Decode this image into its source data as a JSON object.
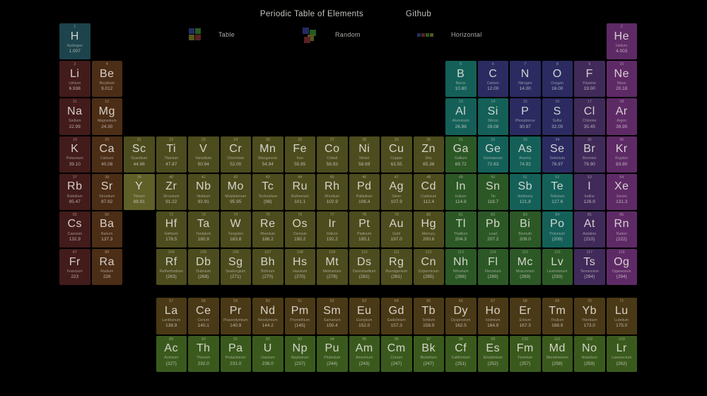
{
  "header": {
    "title": "Periodic Table of Elements",
    "github_label": "Github",
    "modes": [
      {
        "label": "Table"
      },
      {
        "label": "Random"
      },
      {
        "label": "Horizontal"
      }
    ]
  },
  "icon_palette": {
    "blue": "#232c62",
    "red": "#5a2121",
    "green": "#265a21",
    "olive": "#55551e"
  },
  "colors": {
    "hydrogen": "#1d434c",
    "alkali": "#421b1b",
    "alkaline": "#4c2d16",
    "transition": "#4c4c1e",
    "transition_hl": "#5f5f28",
    "post": "#2c5826",
    "metalloid": "#146058",
    "nonmetal": "#2b2b61",
    "halogen": "#402a59",
    "noble": "#5e2a66",
    "lanthanide": "#4a3916",
    "actinide": "#3a5a1d"
  },
  "elements": [
    {
      "n": 1,
      "s": "H",
      "name": "Hydrogen",
      "m": "1.007",
      "r": 1,
      "c": 1,
      "cat": "hydrogen"
    },
    {
      "n": 2,
      "s": "He",
      "name": "Helium",
      "m": "4.003",
      "r": 1,
      "c": 18,
      "cat": "noble"
    },
    {
      "n": 3,
      "s": "Li",
      "name": "Lithium",
      "m": "6.938",
      "r": 2,
      "c": 1,
      "cat": "alkali"
    },
    {
      "n": 4,
      "s": "Be",
      "name": "Beryllium",
      "m": "9.012",
      "r": 2,
      "c": 2,
      "cat": "alkaline"
    },
    {
      "n": 5,
      "s": "B",
      "name": "Boron",
      "m": "10.80",
      "r": 2,
      "c": 13,
      "cat": "metalloid"
    },
    {
      "n": 6,
      "s": "C",
      "name": "Carbon",
      "m": "12.00",
      "r": 2,
      "c": 14,
      "cat": "nonmetal"
    },
    {
      "n": 7,
      "s": "N",
      "name": "Nitrogen",
      "m": "14.00",
      "r": 2,
      "c": 15,
      "cat": "nonmetal"
    },
    {
      "n": 8,
      "s": "O",
      "name": "Oxygen",
      "m": "16.00",
      "r": 2,
      "c": 16,
      "cat": "nonmetal"
    },
    {
      "n": 9,
      "s": "F",
      "name": "Fluorine",
      "m": "19.00",
      "r": 2,
      "c": 17,
      "cat": "halogen"
    },
    {
      "n": 10,
      "s": "Ne",
      "name": "Neon",
      "m": "20.18",
      "r": 2,
      "c": 18,
      "cat": "noble"
    },
    {
      "n": 11,
      "s": "Na",
      "name": "Sodium",
      "m": "22.99",
      "r": 3,
      "c": 1,
      "cat": "alkali"
    },
    {
      "n": 12,
      "s": "Mg",
      "name": "Magnesium",
      "m": "24.30",
      "r": 3,
      "c": 2,
      "cat": "alkaline"
    },
    {
      "n": 13,
      "s": "Al",
      "name": "Aluminium",
      "m": "26.98",
      "r": 3,
      "c": 13,
      "cat": "metalloid"
    },
    {
      "n": 14,
      "s": "Si",
      "name": "Silicon",
      "m": "28.08",
      "r": 3,
      "c": 14,
      "cat": "metalloid"
    },
    {
      "n": 15,
      "s": "P",
      "name": "Phosphorus",
      "m": "30.97",
      "r": 3,
      "c": 15,
      "cat": "nonmetal"
    },
    {
      "n": 16,
      "s": "S",
      "name": "Sulfur",
      "m": "32.05",
      "r": 3,
      "c": 16,
      "cat": "nonmetal"
    },
    {
      "n": 17,
      "s": "Cl",
      "name": "Chlorine",
      "m": "35.45",
      "r": 3,
      "c": 17,
      "cat": "halogen"
    },
    {
      "n": 18,
      "s": "Ar",
      "name": "Argon",
      "m": "39.95",
      "r": 3,
      "c": 18,
      "cat": "noble"
    },
    {
      "n": 19,
      "s": "K",
      "name": "Potassium",
      "m": "39.10",
      "r": 4,
      "c": 1,
      "cat": "alkali"
    },
    {
      "n": 20,
      "s": "Ca",
      "name": "Calcium",
      "m": "40.08",
      "r": 4,
      "c": 2,
      "cat": "alkaline"
    },
    {
      "n": 21,
      "s": "Sc",
      "name": "Scandium",
      "m": "44.96",
      "r": 4,
      "c": 3,
      "cat": "transition"
    },
    {
      "n": 22,
      "s": "Ti",
      "name": "Titanium",
      "m": "47.87",
      "r": 4,
      "c": 4,
      "cat": "transition"
    },
    {
      "n": 23,
      "s": "V",
      "name": "Vanadium",
      "m": "50.94",
      "r": 4,
      "c": 5,
      "cat": "transition"
    },
    {
      "n": 24,
      "s": "Cr",
      "name": "Chromium",
      "m": "52.00",
      "r": 4,
      "c": 6,
      "cat": "transition"
    },
    {
      "n": 25,
      "s": "Mn",
      "name": "Manganese",
      "m": "54.94",
      "r": 4,
      "c": 7,
      "cat": "transition"
    },
    {
      "n": 26,
      "s": "Fe",
      "name": "Iron",
      "m": "55.85",
      "r": 4,
      "c": 8,
      "cat": "transition"
    },
    {
      "n": 27,
      "s": "Co",
      "name": "Cobalt",
      "m": "58.93",
      "r": 4,
      "c": 9,
      "cat": "transition"
    },
    {
      "n": 28,
      "s": "Ni",
      "name": "Nickel",
      "m": "58.69",
      "r": 4,
      "c": 10,
      "cat": "transition"
    },
    {
      "n": 29,
      "s": "Cu",
      "name": "Copper",
      "m": "63.55",
      "r": 4,
      "c": 11,
      "cat": "transition"
    },
    {
      "n": 30,
      "s": "Zn",
      "name": "Zinc",
      "m": "65.38",
      "r": 4,
      "c": 12,
      "cat": "transition"
    },
    {
      "n": 31,
      "s": "Ga",
      "name": "Gallium",
      "m": "69.72",
      "r": 4,
      "c": 13,
      "cat": "post"
    },
    {
      "n": 32,
      "s": "Ge",
      "name": "Germanium",
      "m": "72.63",
      "r": 4,
      "c": 14,
      "cat": "metalloid"
    },
    {
      "n": 33,
      "s": "As",
      "name": "Arsenic",
      "m": "74.92",
      "r": 4,
      "c": 15,
      "cat": "metalloid"
    },
    {
      "n": 34,
      "s": "Se",
      "name": "Selenium",
      "m": "78.97",
      "r": 4,
      "c": 16,
      "cat": "nonmetal"
    },
    {
      "n": 35,
      "s": "Br",
      "name": "Bromine",
      "m": "79.90",
      "r": 4,
      "c": 17,
      "cat": "halogen"
    },
    {
      "n": 36,
      "s": "Kr",
      "name": "Krypton",
      "m": "83.80",
      "r": 4,
      "c": 18,
      "cat": "noble"
    },
    {
      "n": 37,
      "s": "Rb",
      "name": "Rubidium",
      "m": "85.47",
      "r": 5,
      "c": 1,
      "cat": "alkali"
    },
    {
      "n": 38,
      "s": "Sr",
      "name": "Strontium",
      "m": "87.62",
      "r": 5,
      "c": 2,
      "cat": "alkaline"
    },
    {
      "n": 39,
      "s": "Y",
      "name": "Yttrium",
      "m": "88.91",
      "r": 5,
      "c": 3,
      "cat": "transition",
      "hl": true
    },
    {
      "n": 40,
      "s": "Zr",
      "name": "Zirconium",
      "m": "91.22",
      "r": 5,
      "c": 4,
      "cat": "transition"
    },
    {
      "n": 41,
      "s": "Nb",
      "name": "Niobium",
      "m": "92.91",
      "r": 5,
      "c": 5,
      "cat": "transition"
    },
    {
      "n": 42,
      "s": "Mo",
      "name": "Molybdenum",
      "m": "95.95",
      "r": 5,
      "c": 6,
      "cat": "transition"
    },
    {
      "n": 43,
      "s": "Tc",
      "name": "Technetium",
      "m": "(98)",
      "r": 5,
      "c": 7,
      "cat": "transition"
    },
    {
      "n": 44,
      "s": "Ru",
      "name": "Ruthenium",
      "m": "101.1",
      "r": 5,
      "c": 8,
      "cat": "transition"
    },
    {
      "n": 45,
      "s": "Rh",
      "name": "Rhodium",
      "m": "102.9",
      "r": 5,
      "c": 9,
      "cat": "transition"
    },
    {
      "n": 46,
      "s": "Pd",
      "name": "Palladium",
      "m": "106.4",
      "r": 5,
      "c": 10,
      "cat": "transition"
    },
    {
      "n": 47,
      "s": "Ag",
      "name": "Silver",
      "m": "107.9",
      "r": 5,
      "c": 11,
      "cat": "transition"
    },
    {
      "n": 48,
      "s": "Cd",
      "name": "Cadmium",
      "m": "112.4",
      "r": 5,
      "c": 12,
      "cat": "transition"
    },
    {
      "n": 49,
      "s": "In",
      "name": "Indium",
      "m": "114.8",
      "r": 5,
      "c": 13,
      "cat": "post"
    },
    {
      "n": 50,
      "s": "Sn",
      "name": "Tin",
      "m": "118.7",
      "r": 5,
      "c": 14,
      "cat": "post"
    },
    {
      "n": 51,
      "s": "Sb",
      "name": "Antimony",
      "m": "121.8",
      "r": 5,
      "c": 15,
      "cat": "metalloid"
    },
    {
      "n": 52,
      "s": "Te",
      "name": "Tellurium",
      "m": "127.6",
      "r": 5,
      "c": 16,
      "cat": "metalloid"
    },
    {
      "n": 53,
      "s": "I",
      "name": "Iodine",
      "m": "126.9",
      "r": 5,
      "c": 17,
      "cat": "halogen"
    },
    {
      "n": 54,
      "s": "Xe",
      "name": "Xenon",
      "m": "131.3",
      "r": 5,
      "c": 18,
      "cat": "noble"
    },
    {
      "n": 55,
      "s": "Cs",
      "name": "Caesium",
      "m": "132.9",
      "r": 6,
      "c": 1,
      "cat": "alkali"
    },
    {
      "n": 56,
      "s": "Ba",
      "name": "Barium",
      "m": "137.3",
      "r": 6,
      "c": 2,
      "cat": "alkaline"
    },
    {
      "n": 72,
      "s": "Hf",
      "name": "Hafnium",
      "m": "178.5",
      "r": 6,
      "c": 4,
      "cat": "transition"
    },
    {
      "n": 73,
      "s": "Ta",
      "name": "Tantalum",
      "m": "180.9",
      "r": 6,
      "c": 5,
      "cat": "transition"
    },
    {
      "n": 74,
      "s": "W",
      "name": "Tungsten",
      "m": "183.8",
      "r": 6,
      "c": 6,
      "cat": "transition"
    },
    {
      "n": 75,
      "s": "Re",
      "name": "Rhenium",
      "m": "186.2",
      "r": 6,
      "c": 7,
      "cat": "transition"
    },
    {
      "n": 76,
      "s": "Os",
      "name": "Osmium",
      "m": "190.2",
      "r": 6,
      "c": 8,
      "cat": "transition"
    },
    {
      "n": 77,
      "s": "Ir",
      "name": "Iridium",
      "m": "192.2",
      "r": 6,
      "c": 9,
      "cat": "transition"
    },
    {
      "n": 78,
      "s": "Pt",
      "name": "Platinum",
      "m": "195.1",
      "r": 6,
      "c": 10,
      "cat": "transition"
    },
    {
      "n": 79,
      "s": "Au",
      "name": "Gold",
      "m": "197.0",
      "r": 6,
      "c": 11,
      "cat": "transition"
    },
    {
      "n": 80,
      "s": "Hg",
      "name": "Mercury",
      "m": "200.6",
      "r": 6,
      "c": 12,
      "cat": "transition"
    },
    {
      "n": 81,
      "s": "Tl",
      "name": "Thallium",
      "m": "204.3",
      "r": 6,
      "c": 13,
      "cat": "post"
    },
    {
      "n": 82,
      "s": "Pb",
      "name": "Lead",
      "m": "207.2",
      "r": 6,
      "c": 14,
      "cat": "post"
    },
    {
      "n": 83,
      "s": "Bi",
      "name": "Bismuth",
      "m": "209.0",
      "r": 6,
      "c": 15,
      "cat": "post"
    },
    {
      "n": 84,
      "s": "Po",
      "name": "Polonium",
      "m": "(209)",
      "r": 6,
      "c": 16,
      "cat": "metalloid"
    },
    {
      "n": 85,
      "s": "At",
      "name": "Astatine",
      "m": "(210)",
      "r": 6,
      "c": 17,
      "cat": "halogen"
    },
    {
      "n": 86,
      "s": "Rn",
      "name": "Radon",
      "m": "(222)",
      "r": 6,
      "c": 18,
      "cat": "noble"
    },
    {
      "n": 87,
      "s": "Fr",
      "name": "Francium",
      "m": "223",
      "r": 7,
      "c": 1,
      "cat": "alkali"
    },
    {
      "n": 88,
      "s": "Ra",
      "name": "Radium",
      "m": "226",
      "r": 7,
      "c": 2,
      "cat": "alkaline"
    },
    {
      "n": 104,
      "s": "Rf",
      "name": "Rutherfordium",
      "m": "(263)",
      "r": 7,
      "c": 4,
      "cat": "transition"
    },
    {
      "n": 105,
      "s": "Db",
      "name": "Dubnium",
      "m": "(268)",
      "r": 7,
      "c": 5,
      "cat": "transition"
    },
    {
      "n": 106,
      "s": "Sg",
      "name": "Seaborgium",
      "m": "(271)",
      "r": 7,
      "c": 6,
      "cat": "transition"
    },
    {
      "n": 107,
      "s": "Bh",
      "name": "Bohrium",
      "m": "(270)",
      "r": 7,
      "c": 7,
      "cat": "transition"
    },
    {
      "n": 108,
      "s": "Hs",
      "name": "Hassium",
      "m": "(270)",
      "r": 7,
      "c": 8,
      "cat": "transition"
    },
    {
      "n": 109,
      "s": "Mt",
      "name": "Meitnerium",
      "m": "(278)",
      "r": 7,
      "c": 9,
      "cat": "transition"
    },
    {
      "n": 110,
      "s": "Ds",
      "name": "Darmstadtium",
      "m": "(281)",
      "r": 7,
      "c": 10,
      "cat": "transition"
    },
    {
      "n": 111,
      "s": "Rg",
      "name": "Roentgenium",
      "m": "(281)",
      "r": 7,
      "c": 11,
      "cat": "transition"
    },
    {
      "n": 112,
      "s": "Cn",
      "name": "Copernicium",
      "m": "(285)",
      "r": 7,
      "c": 12,
      "cat": "transition"
    },
    {
      "n": 113,
      "s": "Nh",
      "name": "Nihonium",
      "m": "(286)",
      "r": 7,
      "c": 13,
      "cat": "post"
    },
    {
      "n": 114,
      "s": "Fl",
      "name": "Flerovium",
      "m": "(289)",
      "r": 7,
      "c": 14,
      "cat": "post"
    },
    {
      "n": 115,
      "s": "Mc",
      "name": "Moscovium",
      "m": "(289)",
      "r": 7,
      "c": 15,
      "cat": "post"
    },
    {
      "n": 116,
      "s": "Lv",
      "name": "Livermorium",
      "m": "(293)",
      "r": 7,
      "c": 16,
      "cat": "post"
    },
    {
      "n": 117,
      "s": "Ts",
      "name": "Tennessine",
      "m": "(294)",
      "r": 7,
      "c": 17,
      "cat": "halogen"
    },
    {
      "n": 118,
      "s": "Og",
      "name": "Oganesson",
      "m": "(294)",
      "r": 7,
      "c": 18,
      "cat": "noble"
    },
    {
      "n": 57,
      "s": "La",
      "name": "Lanthanum",
      "m": "138.9",
      "r": 8,
      "c": 4,
      "cat": "lanthanide"
    },
    {
      "n": 58,
      "s": "Ce",
      "name": "Cerium",
      "m": "140.1",
      "r": 8,
      "c": 5,
      "cat": "lanthanide"
    },
    {
      "n": 59,
      "s": "Pr",
      "name": "Praseodymium",
      "m": "140.9",
      "r": 8,
      "c": 6,
      "cat": "lanthanide"
    },
    {
      "n": 60,
      "s": "Nd",
      "name": "Neodymium",
      "m": "144.2",
      "r": 8,
      "c": 7,
      "cat": "lanthanide"
    },
    {
      "n": 61,
      "s": "Pm",
      "name": "Promethium",
      "m": "(145)",
      "r": 8,
      "c": 8,
      "cat": "lanthanide"
    },
    {
      "n": 62,
      "s": "Sm",
      "name": "Samarium",
      "m": "150.4",
      "r": 8,
      "c": 9,
      "cat": "lanthanide"
    },
    {
      "n": 63,
      "s": "Eu",
      "name": "Europium",
      "m": "152.0",
      "r": 8,
      "c": 10,
      "cat": "lanthanide"
    },
    {
      "n": 64,
      "s": "Gd",
      "name": "Gadolinium",
      "m": "157.3",
      "r": 8,
      "c": 11,
      "cat": "lanthanide"
    },
    {
      "n": 65,
      "s": "Tb",
      "name": "Terbium",
      "m": "158.9",
      "r": 8,
      "c": 12,
      "cat": "lanthanide"
    },
    {
      "n": 66,
      "s": "Dy",
      "name": "Dysprosium",
      "m": "162.5",
      "r": 8,
      "c": 13,
      "cat": "lanthanide"
    },
    {
      "n": 67,
      "s": "Ho",
      "name": "Holmium",
      "m": "164.9",
      "r": 8,
      "c": 14,
      "cat": "lanthanide"
    },
    {
      "n": 68,
      "s": "Er",
      "name": "Erbium",
      "m": "167.3",
      "r": 8,
      "c": 15,
      "cat": "lanthanide"
    },
    {
      "n": 69,
      "s": "Tm",
      "name": "Thulium",
      "m": "168.9",
      "r": 8,
      "c": 16,
      "cat": "lanthanide"
    },
    {
      "n": 70,
      "s": "Yb",
      "name": "Ytterbium",
      "m": "173.0",
      "r": 8,
      "c": 17,
      "cat": "lanthanide"
    },
    {
      "n": 71,
      "s": "Lu",
      "name": "Lutetium",
      "m": "175.0",
      "r": 8,
      "c": 18,
      "cat": "lanthanide"
    },
    {
      "n": 89,
      "s": "Ac",
      "name": "Actinium",
      "m": "(227)",
      "r": 9,
      "c": 4,
      "cat": "actinide"
    },
    {
      "n": 90,
      "s": "Th",
      "name": "Thorium",
      "m": "232.0",
      "r": 9,
      "c": 5,
      "cat": "actinide"
    },
    {
      "n": 91,
      "s": "Pa",
      "name": "Protactinium",
      "m": "231.0",
      "r": 9,
      "c": 6,
      "cat": "actinide"
    },
    {
      "n": 92,
      "s": "U",
      "name": "Uranium",
      "m": "238.0",
      "r": 9,
      "c": 7,
      "cat": "actinide"
    },
    {
      "n": 93,
      "s": "Np",
      "name": "Neptunium",
      "m": "(237)",
      "r": 9,
      "c": 8,
      "cat": "actinide"
    },
    {
      "n": 94,
      "s": "Pu",
      "name": "Plutonium",
      "m": "(244)",
      "r": 9,
      "c": 9,
      "cat": "actinide"
    },
    {
      "n": 95,
      "s": "Am",
      "name": "Americium",
      "m": "(243)",
      "r": 9,
      "c": 10,
      "cat": "actinide"
    },
    {
      "n": 96,
      "s": "Cm",
      "name": "Curium",
      "m": "(247)",
      "r": 9,
      "c": 11,
      "cat": "actinide"
    },
    {
      "n": 97,
      "s": "Bk",
      "name": "Berkelium",
      "m": "(247)",
      "r": 9,
      "c": 12,
      "cat": "actinide"
    },
    {
      "n": 98,
      "s": "Cf",
      "name": "Californium",
      "m": "(251)",
      "r": 9,
      "c": 13,
      "cat": "actinide"
    },
    {
      "n": 99,
      "s": "Es",
      "name": "Einsteinium",
      "m": "(252)",
      "r": 9,
      "c": 14,
      "cat": "actinide"
    },
    {
      "n": 100,
      "s": "Fm",
      "name": "Fermium",
      "m": "(257)",
      "r": 9,
      "c": 15,
      "cat": "actinide"
    },
    {
      "n": 101,
      "s": "Md",
      "name": "Mendelevium",
      "m": "(258)",
      "r": 9,
      "c": 16,
      "cat": "actinide"
    },
    {
      "n": 102,
      "s": "No",
      "name": "Nobelium",
      "m": "(259)",
      "r": 9,
      "c": 17,
      "cat": "actinide"
    },
    {
      "n": 103,
      "s": "Lr",
      "name": "Lawrencium",
      "m": "(262)",
      "r": 9,
      "c": 18,
      "cat": "actinide"
    }
  ]
}
